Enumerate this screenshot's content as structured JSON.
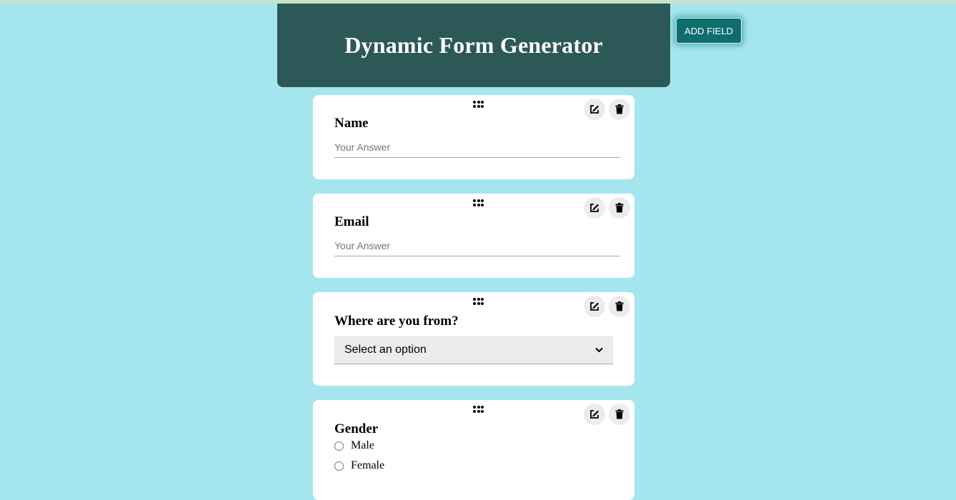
{
  "header": {
    "title": "Dynamic Form Generator"
  },
  "toolbar": {
    "add_field_label": "ADD FIELD"
  },
  "fields": [
    {
      "label": "Name",
      "type": "text",
      "placeholder": "Your Answer",
      "value": ""
    },
    {
      "label": "Email",
      "type": "text",
      "placeholder": "Your Answer",
      "value": ""
    },
    {
      "label": "Where are you from?",
      "type": "select",
      "selected": "Select an option"
    },
    {
      "label": "Gender",
      "type": "radio",
      "options": [
        "Male",
        "Female"
      ]
    }
  ],
  "icons": {
    "drag": "drag-handle-icon",
    "edit": "edit-icon",
    "delete": "trash-icon",
    "dropdown": "chevron-down-icon"
  },
  "colors": {
    "background": "#a5e6ee",
    "header": "#2c5858",
    "button": "#0e6e6e",
    "card": "#ffffff"
  }
}
